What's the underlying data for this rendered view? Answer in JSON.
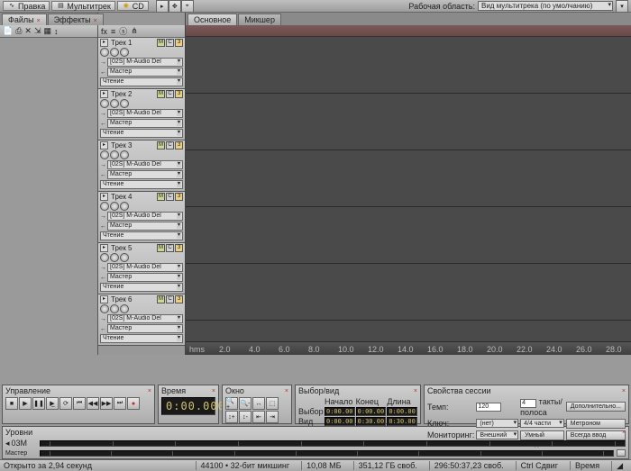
{
  "topbar": {
    "edit": "Правка",
    "multitrack": "Мультитрек",
    "cd": "CD",
    "workspace_lbl": "Рабочая область:",
    "workspace_val": "Вид мультитрека (по умолчанию)"
  },
  "left_tabs": {
    "files": "Файлы",
    "effects": "Эффекты"
  },
  "timeline_tabs": {
    "main": "Основное",
    "mixer": "Микшер"
  },
  "tracks": [
    {
      "name": "Трек 1",
      "input": "[02S] M-Audio Del",
      "master": "Мастер",
      "mode": "Чтение"
    },
    {
      "name": "Трек 2",
      "input": "[02S] M-Audio Del",
      "master": "Мастер",
      "mode": "Чтение"
    },
    {
      "name": "Трек 3",
      "input": "[02S] M-Audio Del",
      "master": "Мастер",
      "mode": "Чтение"
    },
    {
      "name": "Трек 4",
      "input": "[02S] M-Audio Del",
      "master": "Мастер",
      "mode": "Чтение"
    },
    {
      "name": "Трек 5",
      "input": "[02S] M-Audio Del",
      "master": "Мастер",
      "mode": "Чтение"
    },
    {
      "name": "Трек 6",
      "input": "[02S] M-Audio Del",
      "master": "Мастер",
      "mode": "Чтение"
    }
  ],
  "ruler": [
    "hms",
    "2.0",
    "4.0",
    "6.0",
    "8.0",
    "10.0",
    "12.0",
    "14.0",
    "16.0",
    "18.0",
    "20.0",
    "22.0",
    "24.0",
    "26.0",
    "28.0"
  ],
  "transport": {
    "title": "Управление"
  },
  "time": {
    "title": "Время",
    "value": "0:00.000"
  },
  "zoom": {
    "title": "Окно"
  },
  "selection": {
    "title": "Выбор/вид",
    "start_h": "Начало",
    "end_h": "Конец",
    "len_h": "Длина",
    "r1": "Выбор",
    "r2": "Вид",
    "vals": [
      "0:00.000",
      "0:00.000",
      "0:00.000",
      "0:00.000",
      "0:30.000",
      "0:30.000"
    ]
  },
  "props": {
    "title": "Свойства сессии",
    "tempo": "Темп:",
    "tempo_v": "120",
    "bpb": "4",
    "bpb_lbl": "такты/полоса",
    "extra": "Дополнительно...",
    "key": "Ключ:",
    "key_v": "(нет)",
    "meter": "4/4 части",
    "metronome": "Метроном",
    "monitor": "Мониторинг:",
    "monitor_v": "Внешний",
    "smart": "Умный ввод",
    "always": "Всегда ввод"
  },
  "levels": {
    "title": "Уровни",
    "r1": "03M",
    "r2": "Мастер"
  },
  "status": {
    "open": "Открыто за 2,94 секунд",
    "fmt": "44100 • 32-бит микшинг",
    "mem": "10,08 МБ",
    "disk": "351,12 ГБ своб.",
    "dur": "296:50:37,23 своб.",
    "ctrl": "Ctrl Сдвиг",
    "time": "Время"
  }
}
